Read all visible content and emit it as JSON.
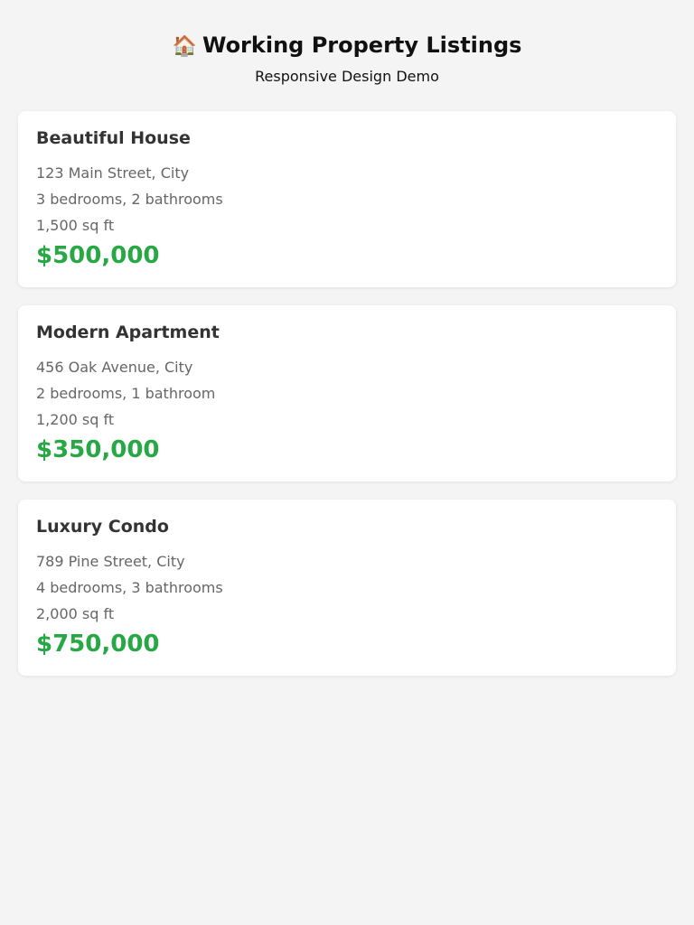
{
  "header": {
    "icon": "house-icon",
    "title": "Working Property Listings",
    "subtitle": "Responsive Design Demo"
  },
  "colors": {
    "background": "#f4f4f4",
    "card": "#ffffff",
    "price": "#28a745",
    "title_text": "#333333",
    "detail_text": "#666666"
  },
  "listings": [
    {
      "title": "Beautiful House",
      "address": "123 Main Street, City",
      "rooms": "3 bedrooms, 2 bathrooms",
      "area": "1,500 sq ft",
      "price": "$500,000"
    },
    {
      "title": "Modern Apartment",
      "address": "456 Oak Avenue, City",
      "rooms": "2 bedrooms, 1 bathroom",
      "area": "1,200 sq ft",
      "price": "$350,000"
    },
    {
      "title": "Luxury Condo",
      "address": "789 Pine Street, City",
      "rooms": "4 bedrooms, 3 bathrooms",
      "area": "2,000 sq ft",
      "price": "$750,000"
    }
  ]
}
